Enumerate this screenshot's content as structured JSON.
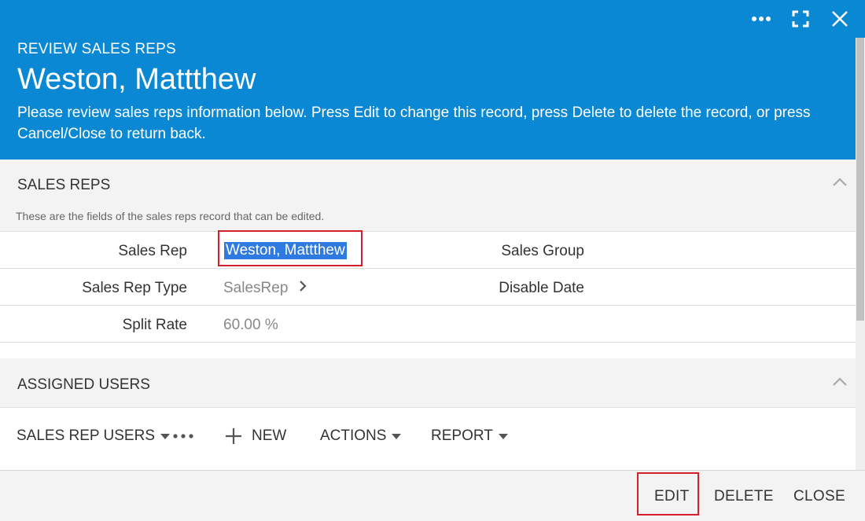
{
  "header": {
    "breadcrumb": "REVIEW SALES REPS",
    "title": "Weston, Mattthew",
    "description": "Please review sales reps information below. Press Edit to change this record, press Delete to delete the record, or press Cancel/Close to return back.",
    "tools": [
      "more-icon",
      "fullscreen-icon",
      "close-icon"
    ],
    "background": "#0a88d4"
  },
  "sales_reps_section": {
    "title": "SALES REPS",
    "note": "These are the fields of the sales reps record that can be edited.",
    "fields": {
      "sales_rep_label": "Sales Rep",
      "sales_rep_value": "Weston, Mattthew",
      "sales_group_label": "Sales Group",
      "sales_rep_type_label": "Sales Rep Type",
      "sales_rep_type_value": "SalesRep",
      "disable_date_label": "Disable Date",
      "split_rate_label": "Split Rate",
      "split_rate_value": "60.00 %"
    }
  },
  "assigned_users_section": {
    "title": "ASSIGNED USERS",
    "toolbar": {
      "sales_rep_users": "SALES REP USERS",
      "new": "NEW",
      "actions": "ACTIONS",
      "report": "REPORT"
    }
  },
  "footer": {
    "edit": "EDIT",
    "delete": "DELETE",
    "close": "CLOSE"
  },
  "colors": {
    "accent": "#0a88d4",
    "highlight_border": "#d4202a",
    "selection": "#2f7ae0"
  }
}
